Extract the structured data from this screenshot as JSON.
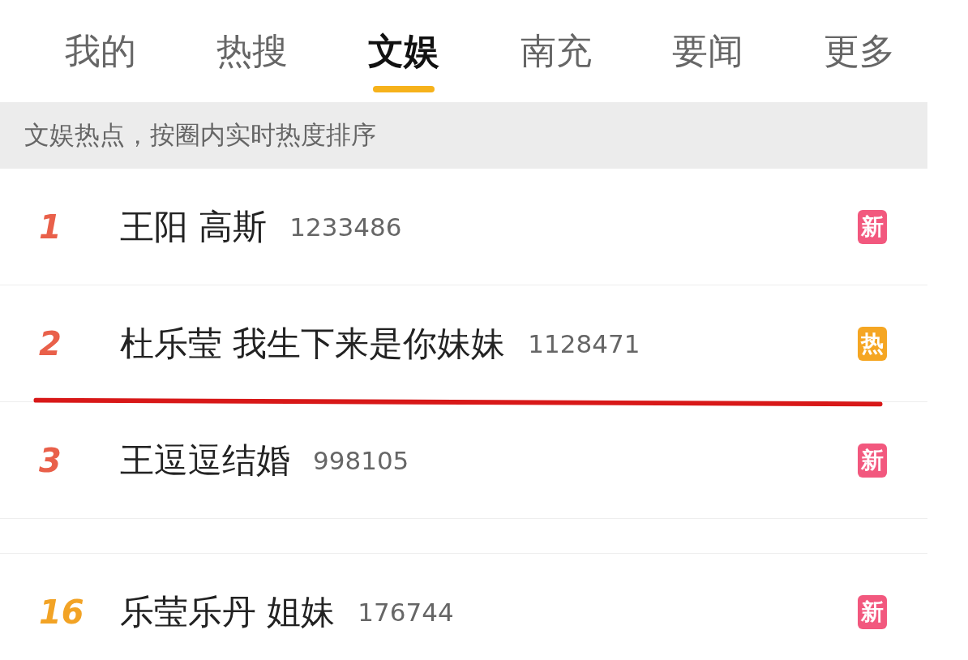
{
  "tabs": [
    {
      "label": "我的",
      "selected": false
    },
    {
      "label": "热搜",
      "selected": false
    },
    {
      "label": "文娱",
      "selected": true
    },
    {
      "label": "南充",
      "selected": false
    },
    {
      "label": "要闻",
      "selected": false
    },
    {
      "label": "更多",
      "selected": false
    }
  ],
  "banner": "文娱热点，按圈内实时热度排序",
  "rows": [
    {
      "rank": "1",
      "color": "#e9604a",
      "title": "王阳 高斯",
      "count": "1233486",
      "badge": {
        "kind": "new",
        "label": "新"
      },
      "underlined": false
    },
    {
      "rank": "2",
      "color": "#e9604a",
      "title": "杜乐莹 我生下来是你妹妹",
      "count": "1128471",
      "badge": {
        "kind": "hot",
        "label": "热"
      },
      "underlined": true
    },
    {
      "rank": "3",
      "color": "#e9604a",
      "title": "王逗逗结婚",
      "count": "998105",
      "badge": {
        "kind": "new",
        "label": "新"
      },
      "underlined": false
    },
    {
      "kind": "gap"
    },
    {
      "rank": "16",
      "color": "#f2a325",
      "title": "乐莹乐丹 姐妹",
      "count": "176744",
      "badge": {
        "kind": "new",
        "label": "新"
      },
      "underlined": false
    }
  ]
}
